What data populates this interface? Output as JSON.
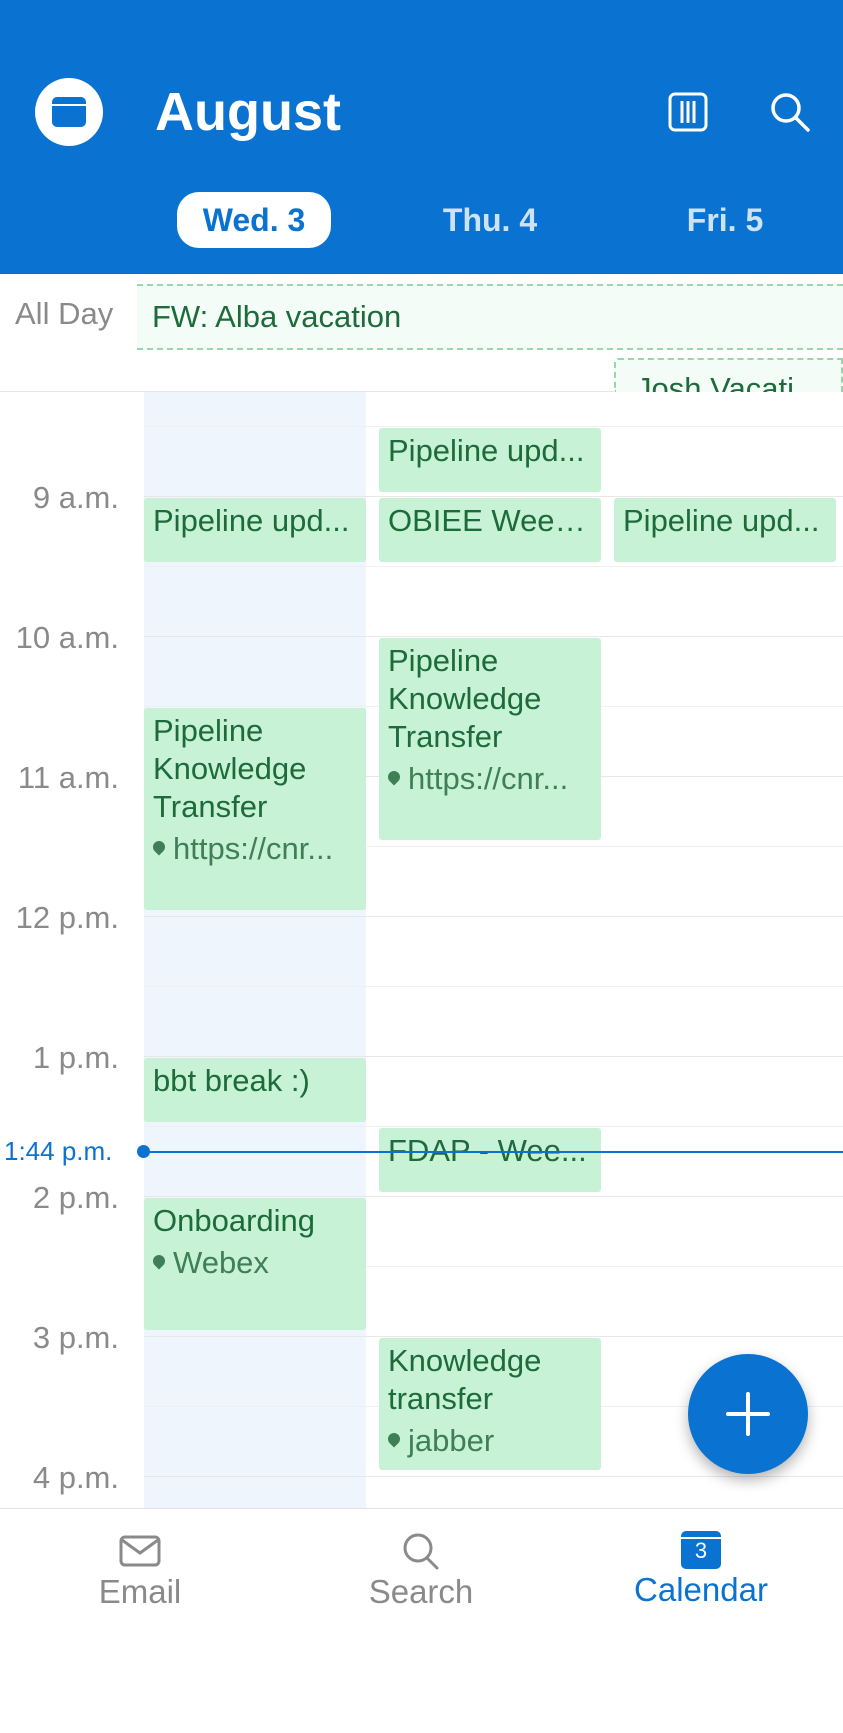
{
  "header": {
    "month": "August",
    "days": [
      {
        "label": "Wed. 3",
        "active": true
      },
      {
        "label": "Thu. 4",
        "active": false
      },
      {
        "label": "Fri. 5",
        "active": false
      }
    ]
  },
  "allday": {
    "label": "All Day",
    "events": [
      {
        "title": "FW: Alba vacation"
      },
      {
        "title": "Josh Vacati"
      }
    ]
  },
  "hours": [
    "9 a.m.",
    "10 a.m.",
    "11 a.m.",
    "12 p.m.",
    "1 p.m.",
    "2 p.m.",
    "3 p.m.",
    "4 p.m."
  ],
  "now": {
    "label": "1:44 p.m."
  },
  "events": {
    "thu_pipeline_1": {
      "title": "Pipeline upd..."
    },
    "wed_pipeline": {
      "title": "Pipeline upd..."
    },
    "thu_obiee": {
      "title": "OBIEE Week..."
    },
    "fri_pipeline": {
      "title": "Pipeline upd..."
    },
    "thu_pkt": {
      "title": "Pipeline Knowledge Transfer",
      "location": "https://cnr..."
    },
    "wed_pkt": {
      "title": "Pipeline Knowledge Transfer",
      "location": "https://cnr..."
    },
    "wed_bbt": {
      "title": "bbt break :)"
    },
    "thu_fdap": {
      "title": "FDAP - Wee..."
    },
    "wed_onboarding": {
      "title": "Onboarding",
      "location": "Webex"
    },
    "thu_kt": {
      "title": "Knowledge transfer",
      "location": "jabber"
    }
  },
  "nav": {
    "email": "Email",
    "search": "Search",
    "calendar": "Calendar",
    "calendar_badge": "3"
  },
  "colors": {
    "accent": "#0a72d1",
    "event_bg": "#c7f2d6",
    "event_text": "#1d6b3a"
  }
}
